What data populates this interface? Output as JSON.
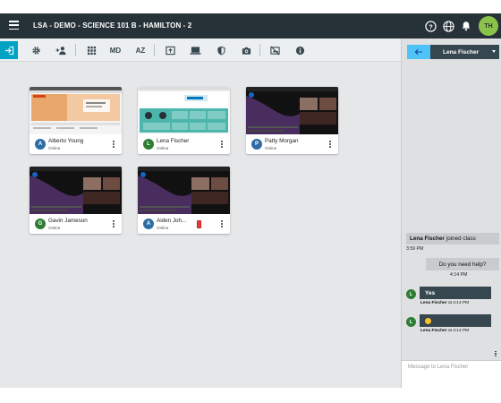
{
  "header": {
    "title": "LSA - DEMO - SCIENCE 101 B - HAMILTON - 2",
    "avatar_initials": "TH",
    "icons": [
      "menu-icon",
      "help-icon",
      "globe-icon",
      "bell-icon"
    ]
  },
  "toolbar": {
    "exit_icon": "exit-icon",
    "md_label": "MD",
    "az_label": "AZ",
    "icons": [
      "gear-icon",
      "add-student-icon",
      "grid-icon",
      "sort-icon",
      "present-icon",
      "screen-icon",
      "shield-icon",
      "camera-icon",
      "hide-screen-icon",
      "info-icon"
    ]
  },
  "students": [
    {
      "initial": "A",
      "name": "Alberto Young",
      "status": "Online",
      "color": "#2e6da4",
      "thumb": "web-a"
    },
    {
      "initial": "L",
      "name": "Lena Fischer",
      "status": "Online",
      "color": "#2e7d32",
      "thumb": "web-b"
    },
    {
      "initial": "P",
      "name": "Patty Morgan",
      "status": "Online",
      "color": "#2e6da4",
      "thumb": "space"
    },
    {
      "initial": "G",
      "name": "Gavin Jameson",
      "status": "Online",
      "color": "#2e7d32",
      "thumb": "space"
    },
    {
      "initial": "A",
      "name": "Aiden Joh...",
      "status": "Online",
      "color": "#2e6da4",
      "thumb": "space"
    }
  ],
  "chat": {
    "selected_student": "Lena Fischer",
    "join_name": "Lena Fischer",
    "join_text": "joined class",
    "join_time": "3:59 PM",
    "outgoing_text": "Do you need help?",
    "outgoing_time": "4:14 PM",
    "reply1_text": "Yes",
    "reply1_from": "Lena Fischer",
    "reply1_time": "at 4:14 PM",
    "reply2_from": "Lena Fischer",
    "reply2_time": "at 4:14 PM",
    "avatar_initial": "L",
    "input_placeholder": "Message to Lena Fischer"
  },
  "colors": {
    "topbar": "#263238",
    "accent": "#00a3c4",
    "online_green": "#2e7d32",
    "online_blue": "#2e6da4",
    "avatar_top": "#8bc34a"
  }
}
